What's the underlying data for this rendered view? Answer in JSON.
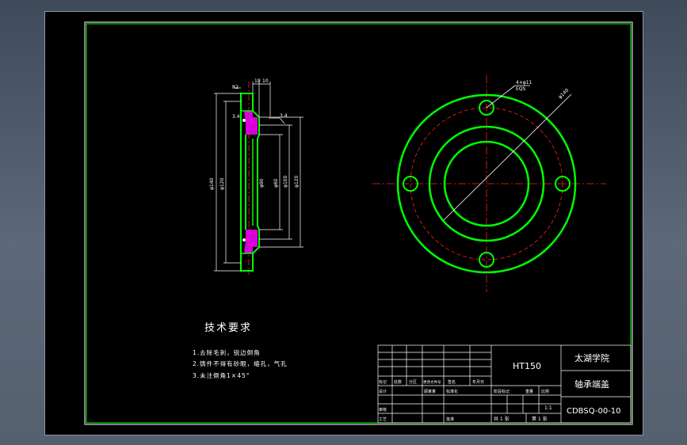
{
  "drawing": {
    "tech_title": "技术要求",
    "notes": [
      "1.去除毛刺，锐边倒角",
      "2.铸件不得有砂眼，缩孔，气孔",
      "3.未注倒角1×45°"
    ],
    "title_block": {
      "material": "HT150",
      "school": "太湖学院",
      "part_name": "轴承端盖",
      "drawing_no": "CDBSQ-00-10",
      "scale": "1:1",
      "sheet_info_left": "共 1 张",
      "sheet_info_right": "第 1 张",
      "row_labels": {
        "mark": "标记",
        "count": "处数",
        "zone": "分区",
        "change_doc": "更改文件号",
        "signature": "签名",
        "date": "年月日",
        "design": "设计",
        "designer": "顾某某",
        "standardize": "标准化",
        "review": "审核",
        "process": "工艺",
        "approve": "批准",
        "stage_mark": "阶段标记",
        "weight": "重量",
        "scale_label": "比例"
      }
    },
    "dimensions": {
      "top_a": "18",
      "top_b": "10",
      "left_small": "R2",
      "chamfer": "3.4",
      "chamfer_right": "3.4",
      "phi_outer": "φ140",
      "phi_mid": "φ120",
      "phi_inner": "φ90",
      "phi_bore": "φ100",
      "phi_hub": "φ60",
      "hole_callout": "4×φ11",
      "hole_pcd": "EQS",
      "pcd_label": "φ120"
    },
    "colors": {
      "outline": "#00ff00",
      "centerline": "#ff2020",
      "dimension": "#ffffff",
      "hatch": "#ff00ff",
      "title_line": "#ffffff"
    }
  }
}
